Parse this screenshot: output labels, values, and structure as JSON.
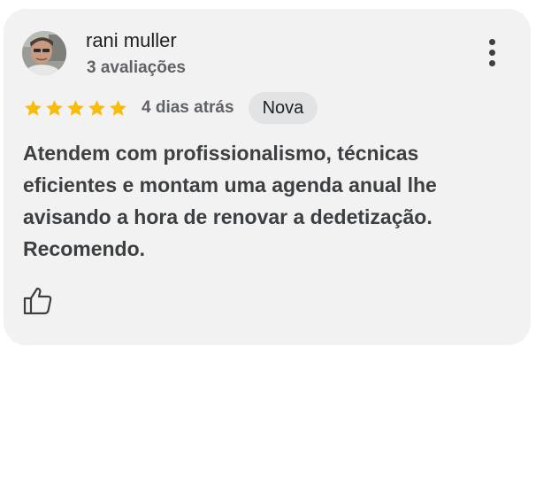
{
  "review": {
    "author": {
      "name": "rani muller",
      "reviews_count": "3 avaliações",
      "avatar_icon": "user-photo-avatar"
    },
    "rating": {
      "value": 5,
      "max": 5,
      "star_color": "#fbbc04",
      "star_icon": "star-icon"
    },
    "date": "4 dias atrás",
    "badge": "Nova",
    "text": "Atendem com profissionalismo, técnicas eficientes e montam uma agenda anual lhe avisando a hora de renovar a dedetização. Recomendo.",
    "actions": {
      "menu_icon": "more-vert-icon",
      "like_icon": "thumbs-up-icon"
    }
  }
}
